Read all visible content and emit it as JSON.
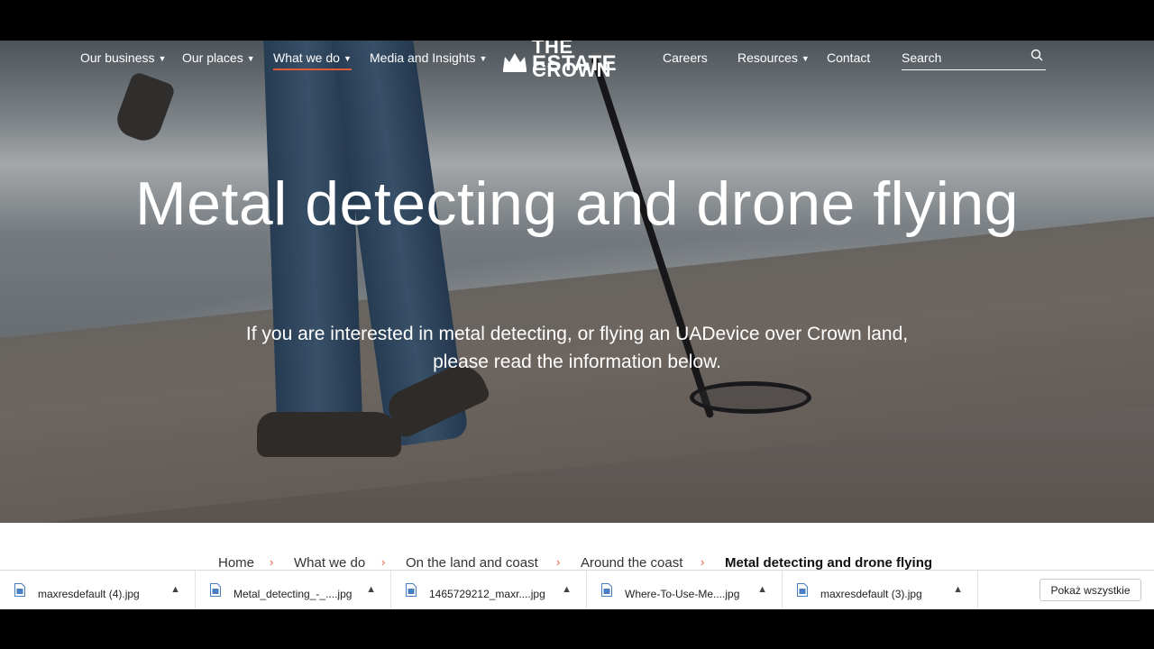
{
  "nav": {
    "items": [
      {
        "label": "Our business",
        "has_dropdown": true
      },
      {
        "label": "Our places",
        "has_dropdown": true
      },
      {
        "label": "What we do",
        "has_dropdown": true,
        "active": true
      },
      {
        "label": "Media and Insights",
        "has_dropdown": true
      },
      {
        "label": "Careers",
        "has_dropdown": false
      },
      {
        "label": "Resources",
        "has_dropdown": true
      },
      {
        "label": "Contact",
        "has_dropdown": false
      }
    ],
    "logo": {
      "line1": "THE CROWN",
      "line2": "ESTATE",
      "icon": "crown-icon"
    },
    "search_placeholder": "Search",
    "search_icon": "search-icon",
    "active_underline_color": "#e05a3a"
  },
  "hero": {
    "title": "Metal detecting and drone flying",
    "subtitle": "If you are interested in metal detecting, or flying an UADevice over Crown land, please read the information below."
  },
  "breadcrumb": {
    "items": [
      "Home",
      "What we do",
      "On the land and coast",
      "Around the coast"
    ],
    "current": "Metal detecting and drone flying",
    "separator": "›",
    "separator_color": "#e05a3a"
  },
  "downloads": {
    "items": [
      {
        "name": "maxresdefault (4).jpg"
      },
      {
        "name": "Metal_detecting_-_....jpg"
      },
      {
        "name": "1465729212_maxr....jpg"
      },
      {
        "name": "Where-To-Use-Me....jpg"
      },
      {
        "name": "maxresdefault (3).jpg"
      }
    ],
    "show_all": "Pokaż wszystkie",
    "item_icon": "image-file-icon",
    "caret_icon": "chevron-up-icon"
  }
}
